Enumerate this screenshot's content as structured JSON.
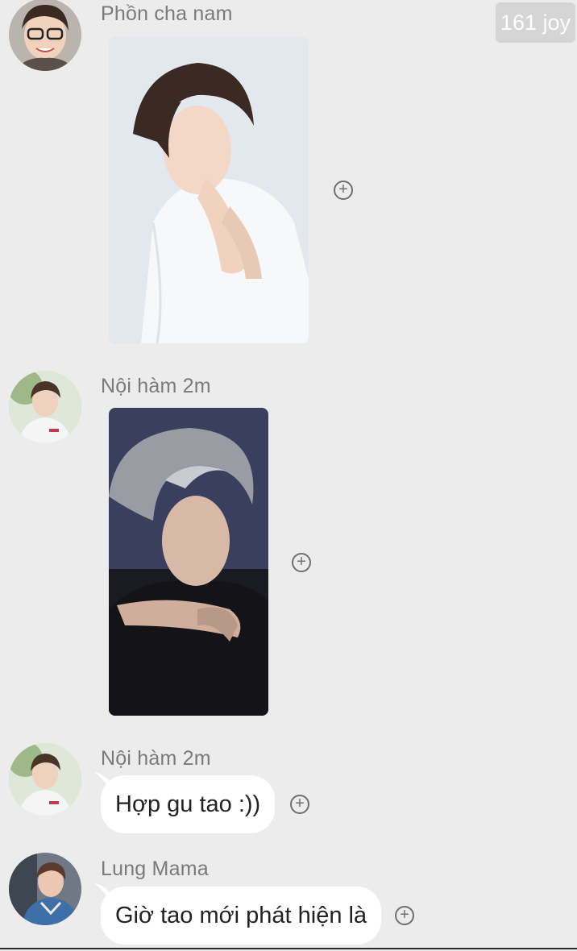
{
  "watermark": "161 joy",
  "messages": [
    {
      "sender": "Phồn cha nam",
      "type": "image",
      "image_desc": "portrait-white-shirt"
    },
    {
      "sender": "Nội hàm 2m",
      "type": "image",
      "image_desc": "portrait-dark-jacket"
    },
    {
      "sender": "Nội hàm 2m",
      "type": "text",
      "text": "Hợp gu tao :))"
    },
    {
      "sender": "Lung Mama",
      "type": "text",
      "text": "Giờ tao mới phát hiện là"
    }
  ],
  "react_symbol": "+",
  "colors": {
    "background": "#ececec",
    "bubble": "#ffffff",
    "sender": "#7a7a7a",
    "watermark_bg": "#d4d4d4"
  }
}
